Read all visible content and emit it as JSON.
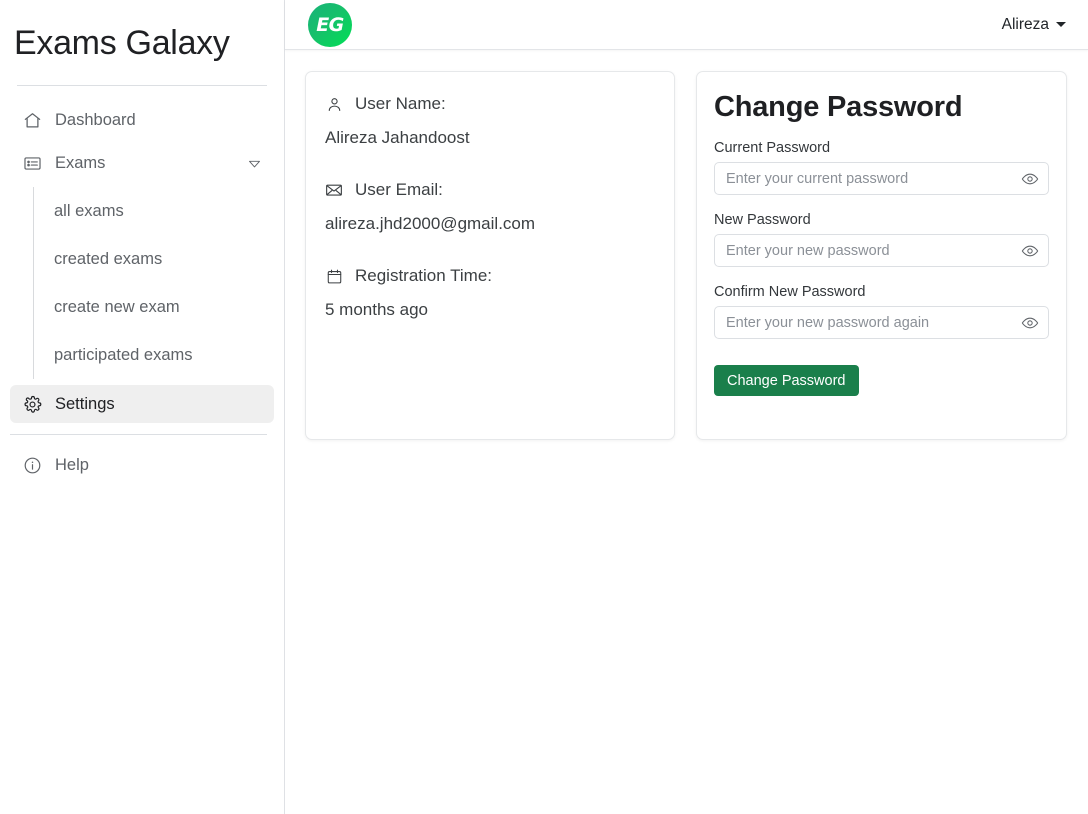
{
  "sidebar": {
    "brand_title": "Exams Galaxy",
    "items": [
      {
        "label": "Dashboard",
        "icon": "home-icon",
        "key": "dashboard"
      },
      {
        "label": "Exams",
        "icon": "list-icon",
        "key": "exams",
        "chevron": "chevron-down-icon"
      },
      {
        "label": "Settings",
        "icon": "gear-icon",
        "key": "settings",
        "active": true
      },
      {
        "label": "Help",
        "icon": "info-icon",
        "key": "help"
      }
    ],
    "submenu": [
      {
        "label": "all exams",
        "key": "all-exams"
      },
      {
        "label": "created exams",
        "key": "created-exams"
      },
      {
        "label": "create new exam",
        "key": "create-new-exam"
      },
      {
        "label": "participated exams",
        "key": "participated-exams"
      }
    ]
  },
  "topbar": {
    "logo_text": "EG",
    "logo_icon": "brand-logo-icon",
    "user_name": "Alireza",
    "caret_icon": "caret-down-icon"
  },
  "user_card": {
    "name_label": "User Name:",
    "name_icon": "person-icon",
    "name_value": "Alireza Jahandoost",
    "email_label": "User Email:",
    "email_icon": "envelope-icon",
    "email_value": "alireza.jhd2000@gmail.com",
    "registration_label": "Registration Time:",
    "registration_icon": "calendar-icon",
    "registration_value": "5 months ago"
  },
  "password_card": {
    "title": "Change Password",
    "current_label": "Current Password",
    "current_placeholder": "Enter your current password",
    "current_value": "",
    "new_label": "New Password",
    "new_placeholder": "Enter your new password",
    "new_value": "",
    "confirm_label": "Confirm New Password",
    "confirm_placeholder": "Enter your new password again",
    "confirm_value": "",
    "eye_icon": "eye-icon",
    "submit_label": "Change Password"
  },
  "colors": {
    "brand_green_start": "#19b27a",
    "brand_green_end": "#00e055",
    "button_green": "#1a7f4b",
    "active_nav_bg": "#efefef",
    "text_muted": "#5f6368",
    "border": "#dcdfe3"
  }
}
